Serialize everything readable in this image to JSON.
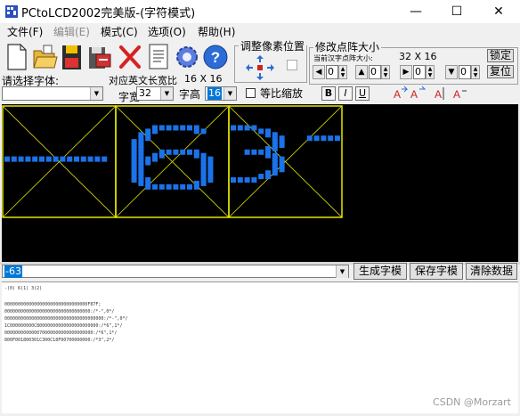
{
  "window": {
    "title": "PCtoLCD2002完美版-(字符模式)",
    "controls": {
      "minimize": "—",
      "maximize": "☐",
      "close": "✕"
    }
  },
  "menu": [
    {
      "label": "文件(F)",
      "disabled": false
    },
    {
      "label": "编辑(E)",
      "disabled": true
    },
    {
      "label": "模式(C)",
      "disabled": false
    },
    {
      "label": "选项(O)",
      "disabled": false
    },
    {
      "label": "帮助(H)",
      "disabled": false
    }
  ],
  "toolbar": {
    "icons": [
      "new-file-icon",
      "open-folder-icon",
      "save-floppy-icon",
      "save-as-icon",
      "delete-x-icon",
      "notes-icon",
      "settings-gear-icon",
      "help-question-icon"
    ]
  },
  "adjust_pixel_group": {
    "title": "调整像素位置"
  },
  "resize_group": {
    "title": "修改点阵大小",
    "current_label": "当前汉字点阵大小:",
    "current_value": "32 X 16",
    "lock_button": "锁定",
    "reset_button": "复位",
    "spinners": [
      "0",
      "0",
      "0",
      "0"
    ]
  },
  "font": {
    "select_label": "请选择字体:",
    "select_value": "",
    "ratio_label": "对应英文长宽比",
    "ratio_value": "16 X 16",
    "width_label": "字宽:",
    "width_value": "32",
    "height_label": "字高",
    "height_value": "16",
    "proportional_label": "等比缩放",
    "bold": "B",
    "italic": "I",
    "underline": "U"
  },
  "input": {
    "text": "-63",
    "generate_button": "生成字模",
    "save_button": "保存字模",
    "clear_button": "清除数据"
  },
  "output_lines": [
    "-(0) 6(1) 3(2)",
    "",
    "0000000000000000000000000000000F87F;",
    "00000000000000000000000000000000:/*-\",0*/",
    "0000000000000000000000000000000000000:/*-\",0*/",
    "1C000000000C80000000000000000000000:/*6\",1*/",
    "000000000000070000000000000000000:/*6\",1*/",
    "800F001800301C300C18F00700000000:/*3\",2*/"
  ],
  "watermark": "CSDN @Morzart",
  "colors": {
    "dot": "#1a73e8",
    "grid": "#e6e600",
    "canvas": "#000000"
  },
  "glyphs": {
    "minus": [
      "0000000000000000",
      "0000000000000000",
      "0000000000000000",
      "0000000000000000",
      "0000000000000000",
      "0000000000000000",
      "0000000000000000",
      "0000000000000000",
      "0000000000000000",
      "0000000000000000",
      "0000000000000000",
      "0000000000000000",
      "0000000000000000",
      "0000000000000000",
      "1111111111111110",
      "0000000000000000",
      "0000000000000000",
      "0000000000000000",
      "0000000000000000",
      "0000000000000000",
      "0000000000000000",
      "0000000000000000",
      "0000000000000000",
      "0000000000000000",
      "0000000000000000",
      "0000000000000000",
      "0000000000000000",
      "0000000000000000",
      "0000000000000000",
      "0000000000000000",
      "0000000000000000",
      "0000000000000000"
    ],
    "six": [
      "0000000000000000",
      "0000000000000000",
      "0000000000000000",
      "0000000000000000",
      "0000000000000000",
      "0000011111110000",
      "0000110000011000",
      "0001100000000000",
      "0001100000000000",
      "0011000000000000",
      "0011000000000000",
      "0011000000000000",
      "0011001111110000",
      "0011011000011000",
      "0011110000001100",
      "0011100000001100",
      "0011000000001100",
      "0011000000001100",
      "0011000000001100",
      "0011000000001100",
      "0011100000001100",
      "0001100000011000",
      "0000111111110000",
      "0000000000000000",
      "0000000000000000",
      "0000000000000000",
      "0000000000000000",
      "0000000000000000",
      "0000000000000000",
      "0000000000000000",
      "0000000000000000",
      "0000000000000000"
    ],
    "three": [
      "0000000000000000",
      "0000000000000000",
      "0000000000000000",
      "0000000000000000",
      "0000000000000000",
      "1111000000000000",
      "0000110000000000",
      "0000011000000000",
      "0000001100011111",
      "0000001100000000",
      "0000001100000000",
      "0000011000000000",
      "0011110000000000",
      "0000011000000000",
      "0000001100000000",
      "0000001100000000",
      "0000001100000000",
      "0000001100000000",
      "0000011000000000",
      "0000110000000000",
      "1111000000000000",
      "0000000000000000",
      "0000000000000000",
      "0000000000000000",
      "0000000000000000",
      "0000000000000000",
      "0000000000000000",
      "0000000000000000",
      "0000000000000000",
      "0000000000000000",
      "0000000000000000",
      "0000000000000000"
    ]
  }
}
